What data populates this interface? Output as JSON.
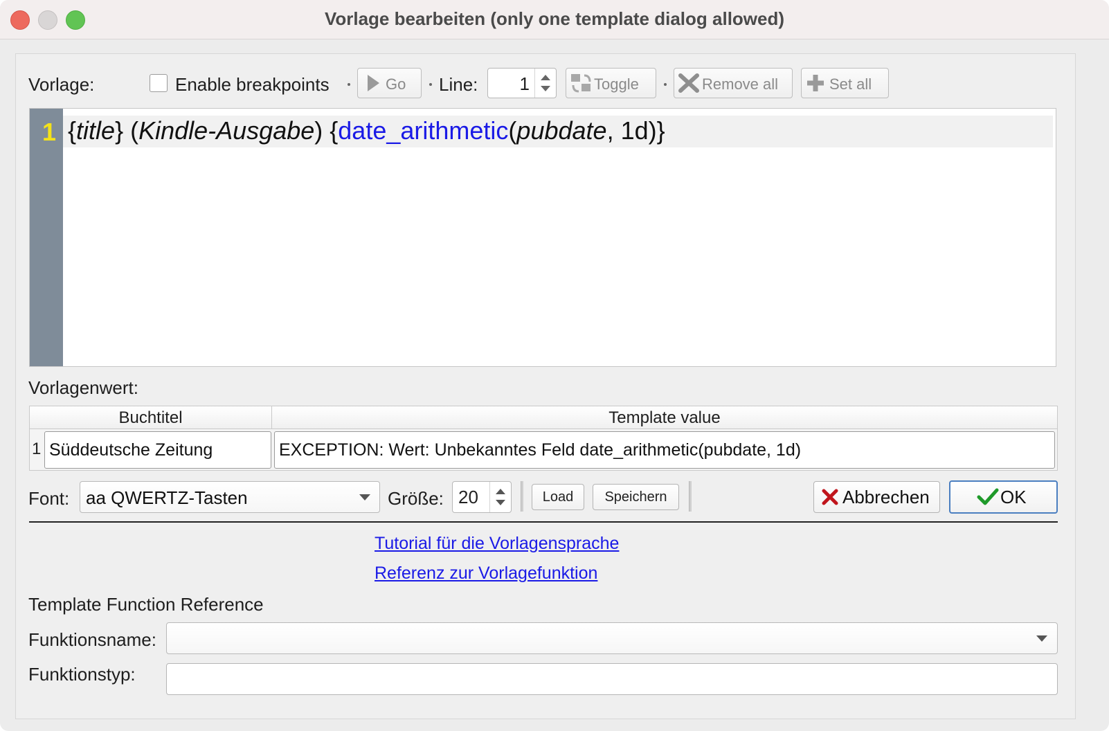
{
  "window": {
    "title": "Vorlage bearbeiten (only one template dialog allowed)"
  },
  "toolbar": {
    "vorlage_label": "Vorlage:",
    "enable_breakpoints_label": "Enable breakpoints",
    "enable_breakpoints_checked": false,
    "go_label": "Go",
    "line_label": "Line:",
    "line_value": "1",
    "toggle_label": "Toggle",
    "remove_all_label": "Remove all",
    "set_all_label": "Set all"
  },
  "editor": {
    "line_number": "1",
    "tokens": {
      "t1": "{",
      "t2": "title",
      "t3": "} (",
      "t4": "Kindle-Ausgabe",
      "t5": ") {",
      "t6": "date_arithmetic",
      "t7": "(",
      "t8": "pubdate",
      "t9": ", 1d)}"
    }
  },
  "result": {
    "section_label": "Vorlagenwert:",
    "columns": [
      "Buchtitel",
      "Template value"
    ],
    "rows": [
      {
        "row_number": "1",
        "book_title": "Süddeutsche Zeitung",
        "template_value": "EXCEPTION: Wert: Unbekanntes Feld date_arithmetic(pubdate, 1d)"
      }
    ]
  },
  "font_bar": {
    "font_label": "Font:",
    "font_value": "aa QWERTZ-Tasten",
    "size_label": "Größe:",
    "size_value": "20",
    "load_label": "Load",
    "save_label": "Speichern",
    "cancel_label": "Abbrechen",
    "ok_label": "OK"
  },
  "links": {
    "tutorial": "Tutorial für die Vorlagensprache",
    "reference": "Referenz zur Vorlagefunktion"
  },
  "function_reference": {
    "heading": "Template Function Reference",
    "name_label": "Funktionsname:",
    "name_value": "",
    "type_label": "Funktionstyp:",
    "type_value": ""
  },
  "colors": {
    "close": "#ed6a5e",
    "maximize": "#61c454",
    "gutter": "#7f8c99",
    "line_number": "#f4e21a",
    "function_token": "#1a1ae6",
    "link": "#1a1ae6",
    "cancel_icon": "#c0151c",
    "ok_icon": "#1f9a2a"
  }
}
